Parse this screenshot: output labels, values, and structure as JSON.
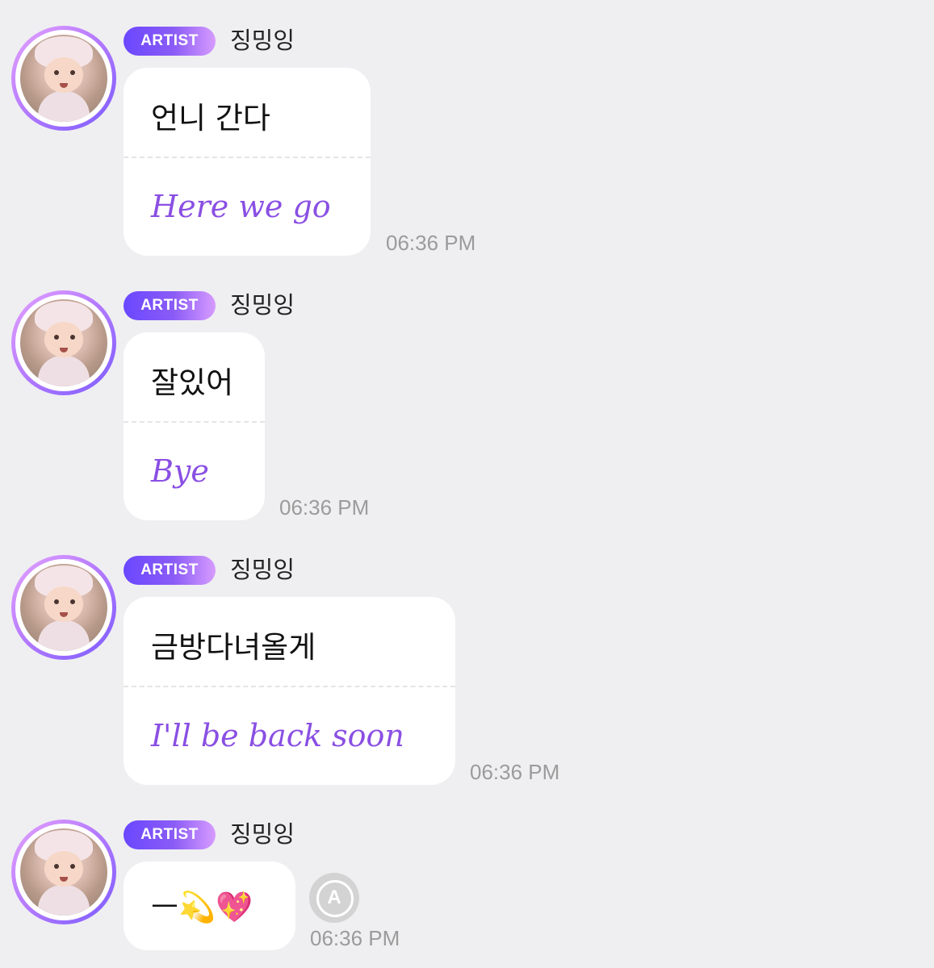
{
  "messages": [
    {
      "badge": "ARTIST",
      "sender": "징밍잉",
      "original": "언니 간다",
      "translation": "Here we go",
      "time": "06:36 PM"
    },
    {
      "badge": "ARTIST",
      "sender": "징밍잉",
      "original": "잘있어",
      "translation": "Bye",
      "time": "06:36 PM"
    },
    {
      "badge": "ARTIST",
      "sender": "징밍잉",
      "original": "금방다녀올게",
      "translation": "I'll be back soon",
      "time": "06:36 PM"
    },
    {
      "badge": "ARTIST",
      "sender": "징밍잉",
      "original": "ㅡ💫💖",
      "time": "06:36 PM",
      "translate_icon": "translate-icon"
    }
  ],
  "colors": {
    "background": "#efeff1",
    "translation_text": "#8a4fe3",
    "badge_gradient_start": "#6a47ff",
    "badge_gradient_end": "#d79cff",
    "timestamp": "#9b9b9b"
  }
}
